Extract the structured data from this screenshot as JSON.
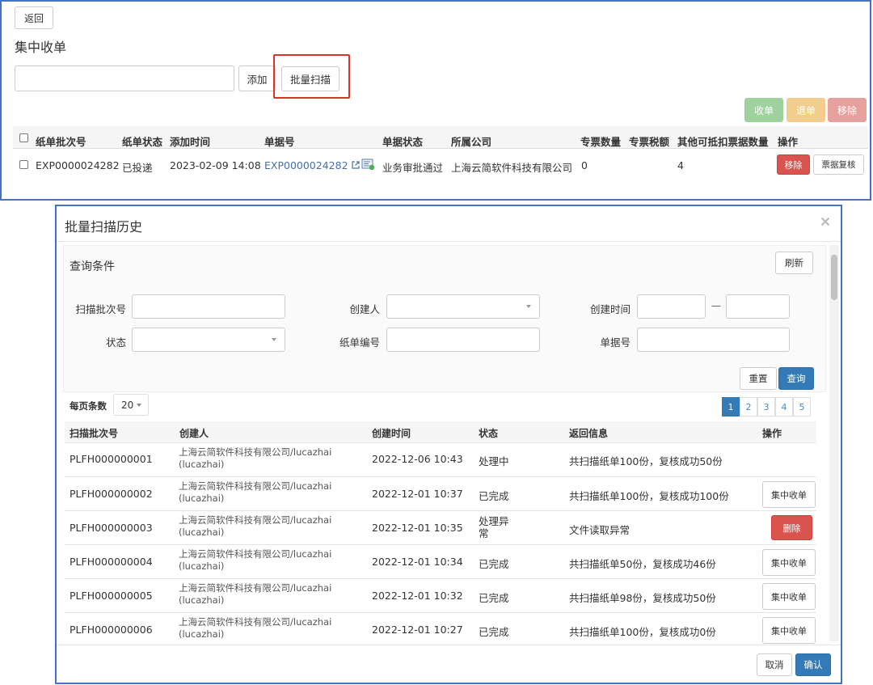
{
  "top": {
    "back_label": "返回",
    "title": "集中收单",
    "add_label": "添加",
    "batch_scan_label": "批量扫描",
    "actions": {
      "receive": "收单",
      "return": "退单",
      "remove": "移除"
    },
    "columns": [
      "纸单批次号",
      "纸单状态",
      "添加时间",
      "单据号",
      "单据状态",
      "所属公司",
      "专票数量",
      "专票税额",
      "其他可抵扣票据数量",
      "操作"
    ],
    "row": {
      "batch_no": "EXP0000024282",
      "paper_status": "已投递",
      "added_time": "2023-02-09 14:08",
      "doc_no": "EXP0000024282",
      "doc_status": "业务审批通过",
      "company": "上海云简软件科技有限公司",
      "special_count": "0",
      "other_count": "4",
      "remove_label": "移除",
      "review_label": "票据复核"
    }
  },
  "modal": {
    "title": "批量扫描历史",
    "query_title": "查询条件",
    "refresh_label": "刷新",
    "labels": {
      "scan_batch_no": "扫描批次号",
      "creator": "创建人",
      "create_time": "创建时间",
      "range_sep": "—",
      "status": "状态",
      "paper_no": "纸单编号",
      "doc_no": "单据号"
    },
    "reset_label": "重置",
    "search_label": "查询",
    "page_size_label": "每页条数",
    "page_size_value": "20",
    "pages": [
      "1",
      "2",
      "3",
      "4",
      "5"
    ],
    "columns": [
      "扫描批次号",
      "创建人",
      "创建时间",
      "状态",
      "返回信息",
      "操作"
    ],
    "rows": [
      {
        "batch": "PLFH000000001",
        "creator1": "上海云简软件科技有限公司/lucazhai",
        "creator2": "(lucazhai)",
        "time": "2022-12-06 10:43",
        "status": "处理中",
        "info": "共扫描纸单100份，复核成功50份",
        "action": ""
      },
      {
        "batch": "PLFH000000002",
        "creator1": "上海云简软件科技有限公司/lucazhai",
        "creator2": "(lucazhai)",
        "time": "2022-12-01 10:37",
        "status": "已完成",
        "info": "共扫描纸单100份，复核成功100份",
        "action": "集中收单"
      },
      {
        "batch": "PLFH000000003",
        "creator1": "上海云简软件科技有限公司/lucazhai",
        "creator2": "(lucazhai)",
        "time": "2022-12-01 10:35",
        "status": "处理异常",
        "info": "文件读取异常",
        "action": "删除"
      },
      {
        "batch": "PLFH000000004",
        "creator1": "上海云简软件科技有限公司/lucazhai",
        "creator2": "(lucazhai)",
        "time": "2022-12-01 10:34",
        "status": "已完成",
        "info": "共扫描纸单50份，复核成功46份",
        "action": "集中收单"
      },
      {
        "batch": "PLFH000000005",
        "creator1": "上海云简软件科技有限公司/lucazhai",
        "creator2": "(lucazhai)",
        "time": "2022-12-01 10:32",
        "status": "已完成",
        "info": "共扫描纸单98份，复核成功50份",
        "action": "集中收单"
      },
      {
        "batch": "PLFH000000006",
        "creator1": "上海云简软件科技有限公司/lucazhai",
        "creator2": "(lucazhai)",
        "time": "2022-12-01 10:27",
        "status": "已完成",
        "info": "共扫描纸单100份，复核成功0份",
        "action": "集中收单"
      }
    ],
    "cancel_label": "取消",
    "confirm_label": "确认"
  },
  "colors": {
    "frame": "#4472c4",
    "highlight": "#d9342b",
    "primary": "#337ab7",
    "danger": "#d9534f",
    "success": "#9fd19f",
    "warning": "#f3cd8e",
    "danger_light": "#e6a19e",
    "link": "#4a6fa5"
  }
}
